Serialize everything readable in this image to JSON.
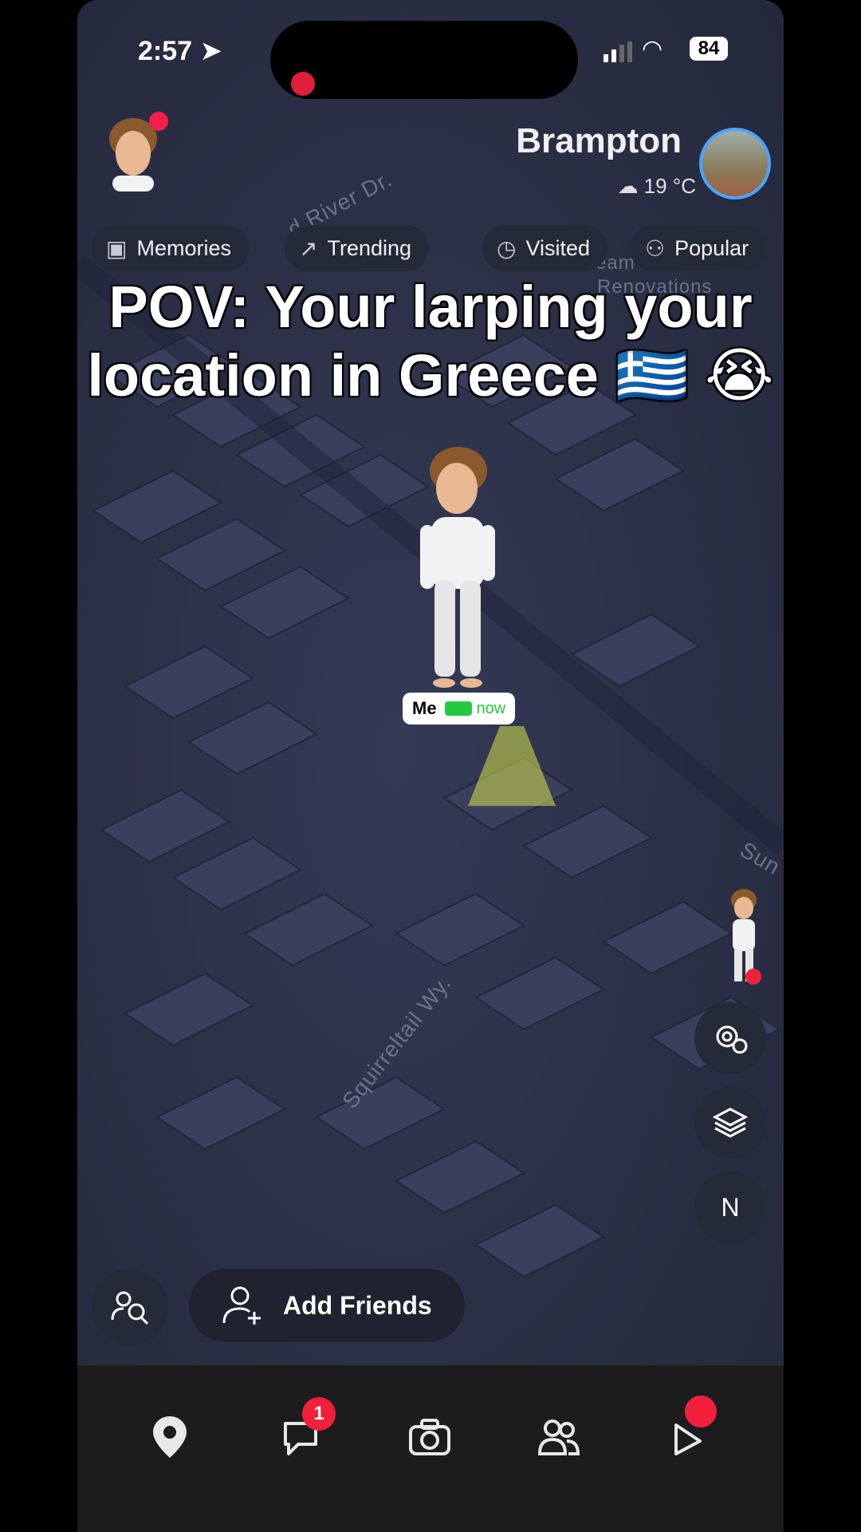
{
  "status_bar": {
    "time": "2:57",
    "battery": "84"
  },
  "location": {
    "city": "Brampton",
    "temperature": "19 °C"
  },
  "filters": [
    {
      "label": "Memories",
      "icon": "memories-icon"
    },
    {
      "label": "Trending",
      "icon": "trending-icon"
    },
    {
      "label": "Visited",
      "icon": "clock-icon"
    },
    {
      "label": "Popular",
      "icon": "people-icon"
    }
  ],
  "caption": {
    "line1": "POV: Your larping your",
    "line2": "location in Greece 🇬🇷 😭"
  },
  "map": {
    "streets": [
      "d River Dr.",
      "Squirreltail Wy.",
      "Sun",
      "eam",
      "Renovations"
    ]
  },
  "me_marker": {
    "name": "Me",
    "status": "now"
  },
  "actions": {
    "add_friends": "Add Friends"
  },
  "compass": {
    "label": "N"
  },
  "tabs": [
    {
      "name": "map",
      "icon": "map-pin-icon"
    },
    {
      "name": "chat",
      "icon": "chat-icon",
      "badge": "1"
    },
    {
      "name": "camera",
      "icon": "camera-icon"
    },
    {
      "name": "stories",
      "icon": "friends-icon"
    },
    {
      "name": "spotlight",
      "icon": "spotlight-icon"
    }
  ],
  "colors": {
    "accent_red": "#f0203d",
    "battery_green": "#25c940",
    "map_bg": "#2b3046"
  }
}
